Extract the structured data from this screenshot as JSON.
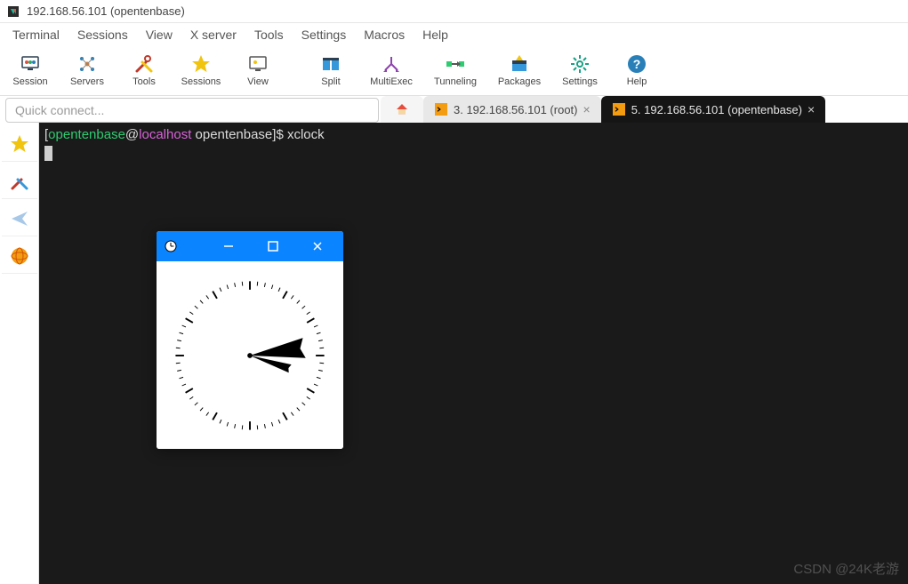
{
  "window": {
    "title": "192.168.56.101 (opentenbase)"
  },
  "menus": {
    "terminal": "Terminal",
    "sessions": "Sessions",
    "view": "View",
    "xserver": "X server",
    "tools": "Tools",
    "settings": "Settings",
    "macros": "Macros",
    "help": "Help"
  },
  "toolbar": {
    "session": "Session",
    "servers": "Servers",
    "tools": "Tools",
    "sessions": "Sessions",
    "view": "View",
    "split": "Split",
    "multiexec": "MultiExec",
    "tunneling": "Tunneling",
    "packages": "Packages",
    "settings": "Settings",
    "help": "Help"
  },
  "quick_connect": {
    "placeholder": "Quick connect..."
  },
  "tabs": {
    "session3": "3. 192.168.56.101 (root)",
    "session5": "5. 192.168.56.101 (opentenbase)"
  },
  "terminal": {
    "prompt_open": "[",
    "prompt_user": "opentenbase",
    "prompt_at": "@",
    "prompt_host": "localhost",
    "prompt_space": " ",
    "prompt_dir": "opentenbase",
    "prompt_close": "]$ ",
    "command": "xclock"
  },
  "xclock": {
    "minimize": "—",
    "maximize": "▢",
    "close": "✕"
  },
  "watermark": "CSDN @24K老游"
}
